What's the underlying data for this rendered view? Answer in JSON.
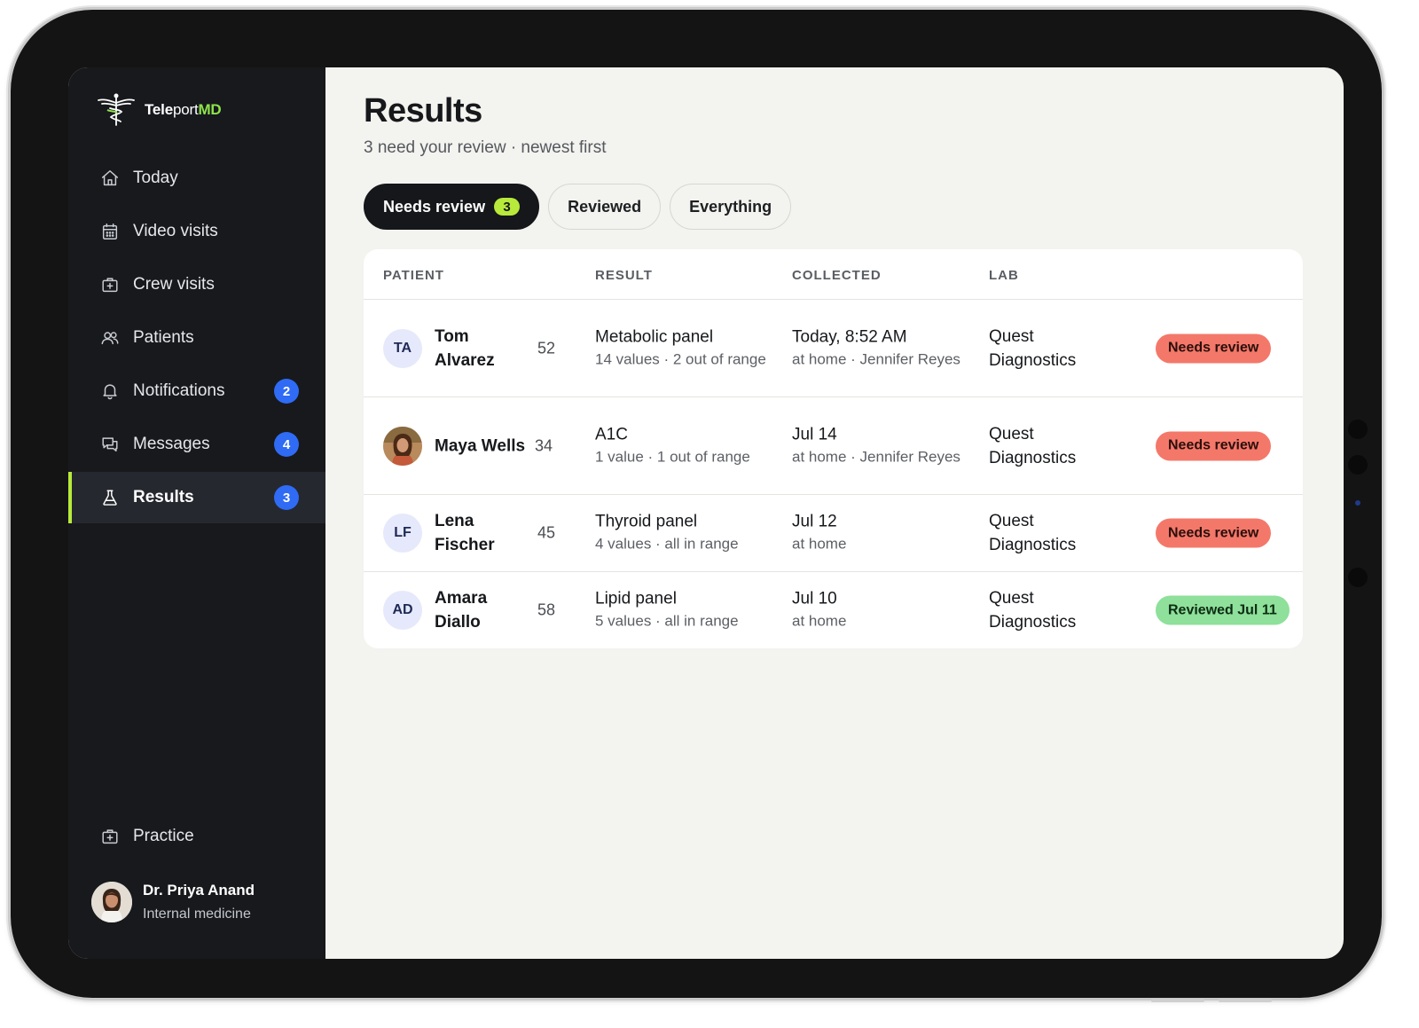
{
  "brand": {
    "name_bold": "Tele",
    "name_light": "port",
    "name_accent": "MD"
  },
  "sidebar": {
    "items": [
      {
        "label": "Today",
        "icon": "home-icon"
      },
      {
        "label": "Video visits",
        "icon": "calendar-icon"
      },
      {
        "label": "Crew visits",
        "icon": "medkit-icon"
      },
      {
        "label": "Patients",
        "icon": "users-icon"
      },
      {
        "label": "Notifications",
        "icon": "bell-icon",
        "badge": "2"
      },
      {
        "label": "Messages",
        "icon": "chat-icon",
        "badge": "4"
      },
      {
        "label": "Results",
        "icon": "flask-icon",
        "badge": "3",
        "active": true
      }
    ],
    "practice_label": "Practice",
    "user": {
      "name": "Dr. Priya Anand",
      "role": "Internal medicine"
    }
  },
  "page": {
    "title": "Results",
    "subtitle": "3 need your review · newest first"
  },
  "tabs": [
    {
      "label": "Needs review",
      "count": "3",
      "active": true
    },
    {
      "label": "Reviewed"
    },
    {
      "label": "Everything"
    }
  ],
  "table": {
    "columns": [
      "PATIENT",
      "RESULT",
      "COLLECTED",
      "LAB"
    ],
    "rows": [
      {
        "initials": "TA",
        "name": "Tom Alvarez",
        "age": "52",
        "result": "Metabolic panel",
        "result_detail": "14 values · 2 out of range",
        "collected": "Today, 8:52 AM",
        "collected_detail": "at home · Jennifer Reyes",
        "lab": "Quest Diagnostics",
        "status": "Needs review",
        "status_type": "needs"
      },
      {
        "initials": "",
        "photo": true,
        "name": "Maya Wells",
        "age": "34",
        "result": "A1C",
        "result_detail": "1 value · 1 out of range",
        "collected": "Jul 14",
        "collected_detail": "at home · Jennifer Reyes",
        "lab": "Quest Diagnostics",
        "status": "Needs review",
        "status_type": "needs"
      },
      {
        "initials": "LF",
        "name": "Lena Fischer",
        "age": "45",
        "result": "Thyroid panel",
        "result_detail": "4 values · all in range",
        "collected": "Jul 12",
        "collected_detail": "at home",
        "lab": "Quest Diagnostics",
        "status": "Needs review",
        "status_type": "needs"
      },
      {
        "initials": "AD",
        "name": "Amara Diallo",
        "age": "58",
        "result": "Lipid panel",
        "result_detail": "5 values · all in range",
        "collected": "Jul 10",
        "collected_detail": "at home",
        "lab": "Quest Diagnostics",
        "status": "Reviewed Jul 11",
        "status_type": "ok"
      }
    ]
  },
  "colors": {
    "accent": "#b7ea3a",
    "badge_blue": "#2f6bf4",
    "needs_review": "#f4786a",
    "reviewed": "#8ee09a",
    "sidebar_bg": "#17191d"
  }
}
